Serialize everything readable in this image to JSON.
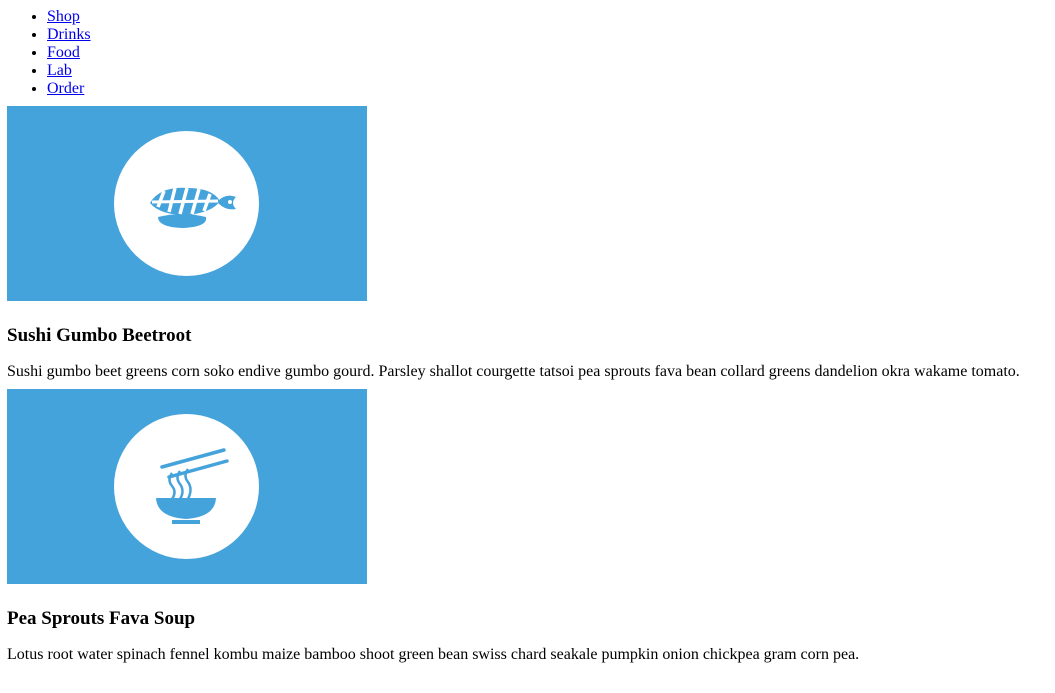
{
  "nav": {
    "items": [
      {
        "label": "Shop"
      },
      {
        "label": "Drinks"
      },
      {
        "label": "Food"
      },
      {
        "label": "Lab"
      },
      {
        "label": "Order"
      }
    ]
  },
  "colors": {
    "banner": "#45a3db",
    "link": "#0000ee"
  },
  "cards": [
    {
      "icon": "sushi-icon",
      "title": "Sushi Gumbo Beetroot",
      "description": "Sushi gumbo beet greens corn soko endive gumbo gourd. Parsley shallot courgette tatsoi pea sprouts fava bean collard greens dandelion okra wakame tomato."
    },
    {
      "icon": "noodle-bowl-icon",
      "title": "Pea Sprouts Fava Soup",
      "description": "Lotus root water spinach fennel kombu maize bamboo shoot green bean swiss chard seakale pumpkin onion chickpea gram corn pea."
    }
  ]
}
